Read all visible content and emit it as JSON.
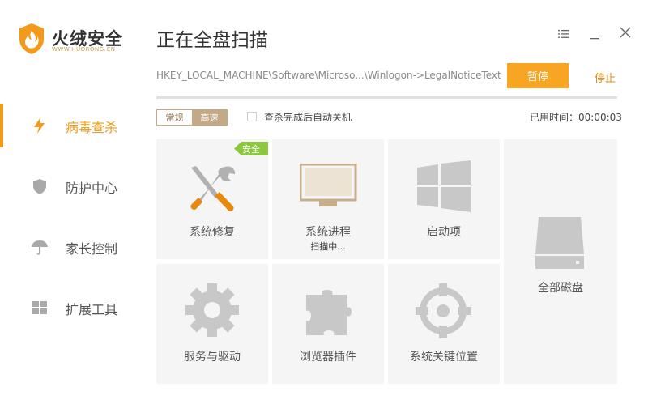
{
  "brand": {
    "name": "火绒安全",
    "sub": "WWW.HUORONG.CN"
  },
  "sidebar": {
    "items": [
      {
        "label": "病毒查杀",
        "icon": "lightning-icon",
        "active": true
      },
      {
        "label": "防护中心",
        "icon": "shield-icon",
        "active": false
      },
      {
        "label": "家长控制",
        "icon": "umbrella-icon",
        "active": false
      },
      {
        "label": "扩展工具",
        "icon": "grid-icon",
        "active": false
      }
    ]
  },
  "header": {
    "title": "正在全盘扫描",
    "menu_icon": "menu-icon",
    "minimize_icon": "minimize-icon",
    "close_icon": "close-icon"
  },
  "scan": {
    "path": "HKEY_LOCAL_MACHINE\\Software\\Microso...\\Winlogon->LegalNoticeText",
    "pause_label": "暂停",
    "stop_label": "停止",
    "mode_normal": "常规",
    "mode_fast": "高速",
    "mode_selected": "高速",
    "auto_shutdown_label": "查杀完成后自动关机",
    "auto_shutdown_checked": false,
    "elapsed": "已用时间：00:00:03"
  },
  "tiles": [
    {
      "label": "系统修复",
      "icon": "wrench-screwdriver-icon",
      "badge": "安全"
    },
    {
      "label": "系统进程",
      "icon": "monitor-icon",
      "status": "扫描中..."
    },
    {
      "label": "启动项",
      "icon": "windows-logo-icon"
    },
    {
      "label": "全部磁盘",
      "icon": "hard-disk-icon"
    },
    {
      "label": "服务与驱动",
      "icon": "gear-icon"
    },
    {
      "label": "浏览器插件",
      "icon": "puzzle-icon"
    },
    {
      "label": "系统关键位置",
      "icon": "crosshair-icon"
    }
  ],
  "colors": {
    "accent": "#f29b1a",
    "pause_bg": "#f6a623",
    "safe_badge": "#8dc63f",
    "tile_bg": "#f5f5f5",
    "mode_on": "#c4a986"
  }
}
